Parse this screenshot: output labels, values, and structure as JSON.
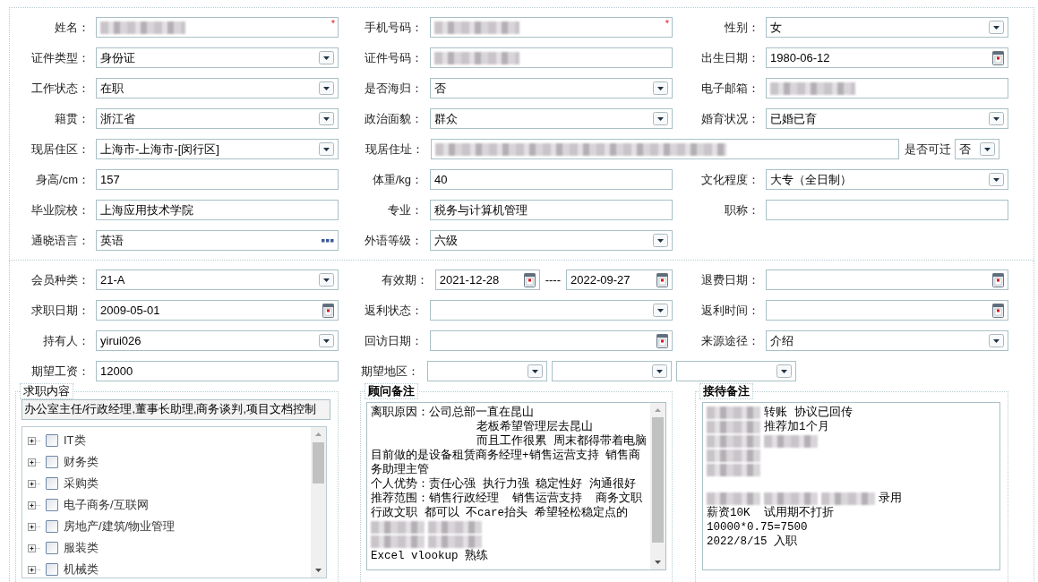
{
  "profile": {
    "rows": [
      [
        {
          "label": "姓名：",
          "kind": "text",
          "redacted": true,
          "required_mark": "*"
        },
        {
          "label": "手机号码：",
          "kind": "text",
          "redacted": true,
          "required_mark": "*"
        },
        {
          "label": "性别：",
          "kind": "select",
          "value": "女"
        }
      ],
      [
        {
          "label": "证件类型：",
          "kind": "select",
          "value": "身份证"
        },
        {
          "label": "证件号码：",
          "kind": "text",
          "redacted": true
        },
        {
          "label": "出生日期：",
          "kind": "date",
          "value": "1980-06-12"
        }
      ],
      [
        {
          "label": "工作状态：",
          "kind": "select",
          "value": "在职"
        },
        {
          "label": "是否海归：",
          "kind": "select",
          "value": "否"
        },
        {
          "label": "电子邮箱：",
          "kind": "text",
          "redacted": true
        }
      ],
      [
        {
          "label": "籍贯：",
          "kind": "select",
          "value": "浙江省"
        },
        {
          "label": "政治面貌：",
          "kind": "select",
          "value": "群众"
        },
        {
          "label": "婚育状况：",
          "kind": "select",
          "value": "已婚已育"
        }
      ],
      [
        {
          "label": "现居住区：",
          "kind": "select",
          "value": "上海市-上海市-[闵行区]"
        },
        {
          "label": "现居住址：",
          "kind": "address",
          "redacted": true,
          "extra": {
            "label": "是否可迁",
            "value": "否"
          }
        }
      ],
      [
        {
          "label": "身高/cm：",
          "kind": "text",
          "value": "157"
        },
        {
          "label": "体重/kg：",
          "kind": "text",
          "value": "40"
        },
        {
          "label": "文化程度：",
          "kind": "select",
          "value": "大专（全日制）"
        }
      ],
      [
        {
          "label": "毕业院校：",
          "kind": "text",
          "value": "上海应用技术学院"
        },
        {
          "label": "专业：",
          "kind": "text",
          "value": "税务与计算机管理"
        },
        {
          "label": "职称：",
          "kind": "text"
        }
      ],
      [
        {
          "label": "通晓语言：",
          "kind": "lookup",
          "value": "英语"
        },
        {
          "label": "外语等级：",
          "kind": "select",
          "value": "六级"
        }
      ]
    ]
  },
  "membership": {
    "rows": [
      [
        {
          "label": "会员种类：",
          "kind": "select",
          "value": "21-A"
        },
        {
          "label": "有效期：",
          "kind": "range",
          "from": "2021-12-28",
          "separator": "----",
          "to": "2022-09-27"
        },
        {
          "label": "退费日期：",
          "kind": "date"
        }
      ],
      [
        {
          "label": "求职日期：",
          "kind": "date",
          "value": "2009-05-01"
        },
        {
          "label": "返利状态：",
          "kind": "select"
        },
        {
          "label": "返利时间：",
          "kind": "date"
        }
      ],
      [
        {
          "label": "持有人：",
          "kind": "select",
          "value": "yirui026"
        },
        {
          "label": "回访日期：",
          "kind": "date"
        },
        {
          "label": "来源途径：",
          "kind": "select",
          "value": "介绍"
        }
      ],
      [
        {
          "label": "期望工资：",
          "kind": "text",
          "value": "12000"
        },
        {
          "label": "期望地区：",
          "kind": "region"
        }
      ]
    ]
  },
  "job_content": {
    "legend": "求职内容",
    "bold": false,
    "summary": "办公室主任/行政经理,董事长助理,商务谈判,项目文档控制",
    "categories": [
      {
        "label": "IT类",
        "expanded": false,
        "checked": false
      },
      {
        "label": "财务类",
        "expanded": false,
        "checked": false
      },
      {
        "label": "采购类",
        "expanded": false,
        "checked": false
      },
      {
        "label": "电子商务/互联网",
        "expanded": false,
        "checked": false
      },
      {
        "label": "房地产/建筑/物业管理",
        "expanded": false,
        "checked": false
      },
      {
        "label": "服装类",
        "expanded": false,
        "checked": false
      },
      {
        "label": "机械类",
        "expanded": false,
        "checked": false
      }
    ]
  },
  "advisor_notes": {
    "legend": "顾问备注",
    "bold": true,
    "lines": [
      {
        "parts": [
          {
            "kind": "text",
            "text": "离职原因：公司总部一直在昆山"
          }
        ]
      },
      {
        "indent": true,
        "parts": [
          {
            "kind": "text",
            "text": "老板希望管理层去昆山"
          }
        ]
      },
      {
        "indent": true,
        "parts": [
          {
            "kind": "text",
            "text": "而且工作很累 周末都得带着电脑"
          }
        ]
      },
      {
        "parts": [
          {
            "kind": "text",
            "text": "目前做的是设备租赁商务经理+销售运营支持 销售商"
          }
        ]
      },
      {
        "parts": [
          {
            "kind": "text",
            "text": "务助理主管"
          }
        ]
      },
      {
        "parts": [
          {
            "kind": "text",
            "text": "个人优势：责任心强 执行力强 稳定性好 沟通很好"
          }
        ]
      },
      {
        "parts": [
          {
            "kind": "text",
            "text": "推荐范围：销售行政经理  销售运营支持  商务文职"
          }
        ]
      },
      {
        "parts": [
          {
            "kind": "text",
            "text": "行政文职 都可以 不care抬头 希望轻松稳定点的"
          }
        ]
      },
      {
        "parts": [
          {
            "kind": "redacted"
          },
          {
            "kind": "redacted"
          }
        ]
      },
      {
        "parts": [
          {
            "kind": "redacted"
          },
          {
            "kind": "redacted"
          }
        ]
      },
      {
        "parts": [
          {
            "kind": "text",
            "text": "Excel vlookup 熟练"
          }
        ]
      }
    ]
  },
  "reception_notes": {
    "legend": "接待备注",
    "bold": true,
    "lines": [
      {
        "parts": [
          {
            "kind": "redacted"
          },
          {
            "kind": "text",
            "text": "转账 协议已回传"
          }
        ]
      },
      {
        "parts": [
          {
            "kind": "redacted"
          },
          {
            "kind": "text",
            "text": "推荐加1个月"
          }
        ]
      },
      {
        "parts": [
          {
            "kind": "redacted"
          },
          {
            "kind": "redacted"
          }
        ]
      },
      {
        "parts": [
          {
            "kind": "redacted"
          }
        ]
      },
      {
        "parts": [
          {
            "kind": "redacted"
          }
        ]
      },
      {
        "gap_before": true,
        "parts": [
          {
            "kind": "redacted"
          },
          {
            "kind": "redacted"
          },
          {
            "kind": "redacted"
          },
          {
            "kind": "text",
            "text": "录用"
          }
        ]
      },
      {
        "parts": [
          {
            "kind": "text",
            "text": "薪资10K  试用期不打折"
          }
        ]
      },
      {
        "parts": [
          {
            "kind": "text",
            "text": "10000*0.75=7500"
          }
        ]
      },
      {
        "parts": [
          {
            "kind": "text",
            "text": "2022/8/15 入职"
          }
        ]
      }
    ]
  }
}
